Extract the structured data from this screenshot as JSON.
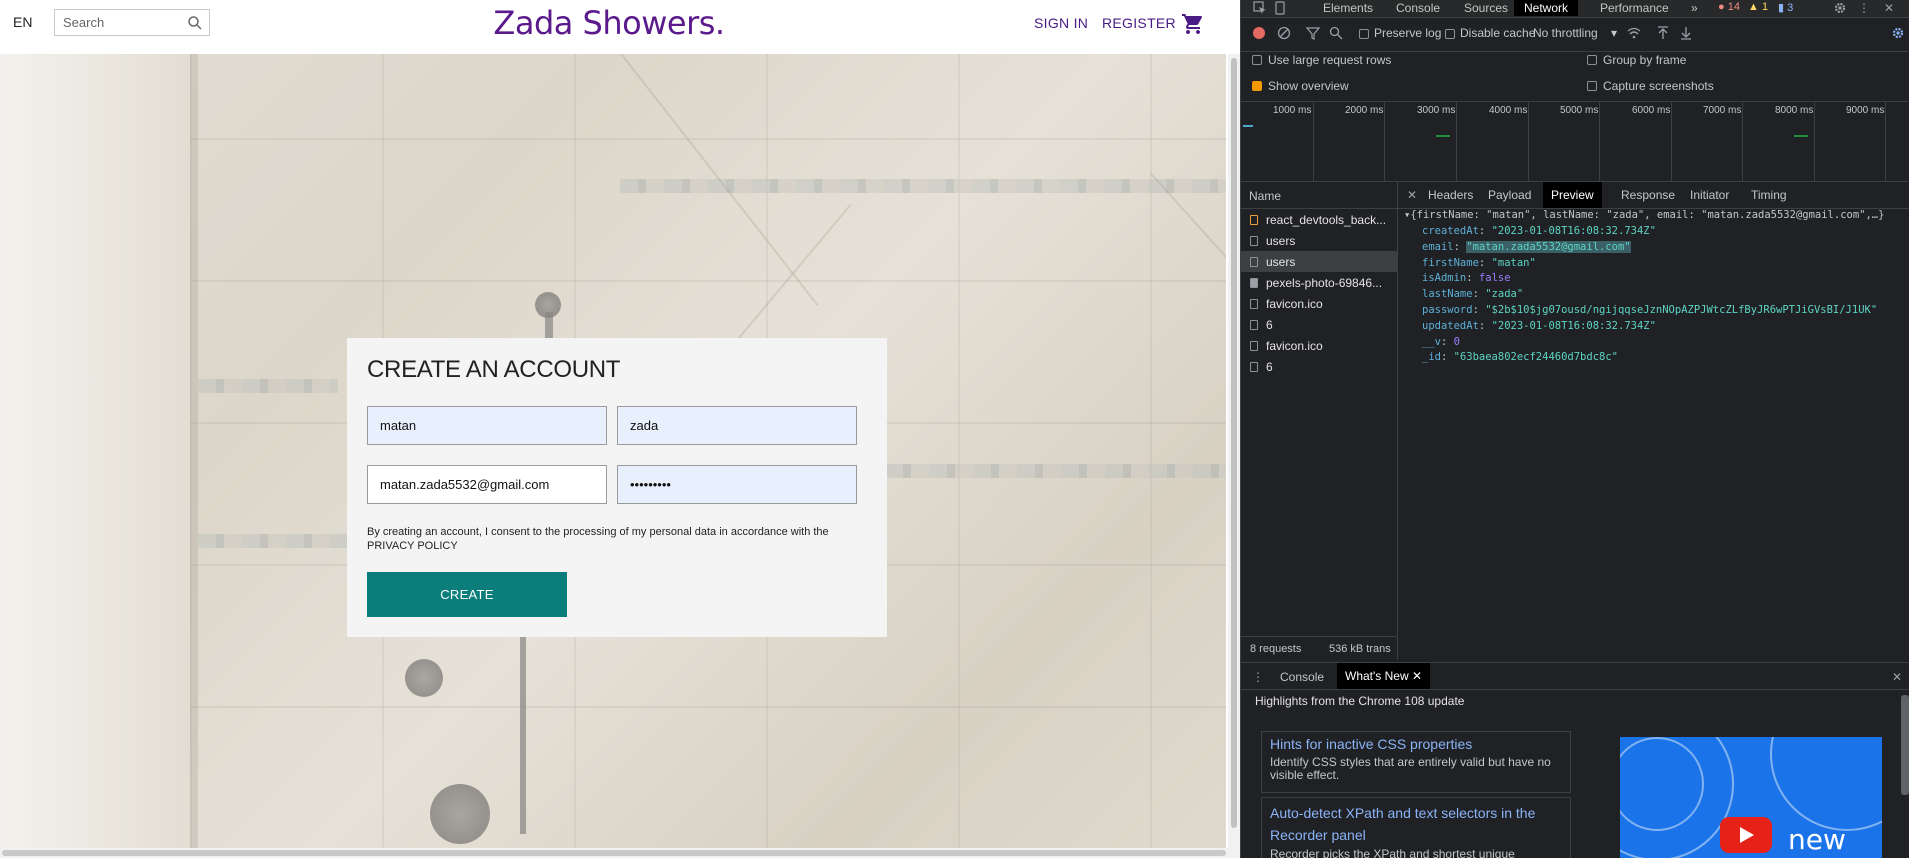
{
  "site": {
    "lang": "EN",
    "search_placeholder": "Search",
    "logo": "Zada Showers.",
    "nav": {
      "sign_in": "SIGN IN",
      "register": "REGISTER"
    },
    "form": {
      "title": "CREATE AN ACCOUNT",
      "first_name": "matan",
      "last_name": "zada",
      "email": "matan.zada5532@gmail.com",
      "password": "•••••••••",
      "consent_text": "By creating an account, I consent to the processing of my personal data in accordance with the",
      "consent_link": "PRIVACY POLICY",
      "create_label": "CREATE"
    }
  },
  "devtools": {
    "tabs": [
      "Elements",
      "Console",
      "Sources",
      "Network",
      "Performance"
    ],
    "active_tab": "Network",
    "more": "»",
    "badges": {
      "errors": "14",
      "warnings": "1",
      "messages": "3"
    },
    "toolbar": {
      "preserve_log": "Preserve log",
      "disable_cache": "Disable cache",
      "throttling": "No throttling"
    },
    "options": {
      "large_rows": "Use large request rows",
      "show_overview": "Show overview",
      "group_by_frame": "Group by frame",
      "capture_screenshots": "Capture screenshots"
    },
    "timeline": [
      "1000 ms",
      "2000 ms",
      "3000 ms",
      "4000 ms",
      "5000 ms",
      "6000 ms",
      "7000 ms",
      "8000 ms",
      "9000 ms"
    ],
    "name_header": "Name",
    "requests": [
      "react_devtools_back...",
      "users",
      "users",
      "pexels-photo-69846...",
      "favicon.ico",
      "6",
      "favicon.ico",
      "6"
    ],
    "status": {
      "requests": "8 requests",
      "transferred": "536 kB trans"
    },
    "detail_tabs": [
      "Headers",
      "Payload",
      "Preview",
      "Response",
      "Initiator",
      "Timing"
    ],
    "active_detail": "Preview",
    "preview": {
      "summary": "{firstName: \"matan\", lastName: \"zada\", email: \"matan.zada5532@gmail.com\",…}",
      "fields": [
        {
          "key": "createdAt",
          "value": "\"2023-01-08T16:08:32.734Z\"",
          "type": "s"
        },
        {
          "key": "email",
          "value": "\"matan.zada5532@gmail.com\"",
          "type": "s"
        },
        {
          "key": "firstName",
          "value": "\"matan\"",
          "type": "s"
        },
        {
          "key": "isAdmin",
          "value": "false",
          "type": "b"
        },
        {
          "key": "lastName",
          "value": "\"zada\"",
          "type": "s"
        },
        {
          "key": "password",
          "value": "\"$2b$10$jg07ousd/ngijqqseJznNOpAZPJWtcZLfByJR6wPTJiGVsBI/J1UK\"",
          "type": "s"
        },
        {
          "key": "updatedAt",
          "value": "\"2023-01-08T16:08:32.734Z\"",
          "type": "s"
        },
        {
          "key": "__v",
          "value": "0",
          "type": "n"
        },
        {
          "key": "_id",
          "value": "\"63baea802ecf24460d7bdc8c\"",
          "type": "s"
        }
      ]
    },
    "drawer": {
      "tabs": [
        "Console",
        "What's New"
      ],
      "active": "What's New",
      "headline": "Highlights from the Chrome 108 update",
      "cards": [
        {
          "title": "Hints for inactive CSS properties",
          "desc": "Identify CSS styles that are entirely valid but have no visible effect."
        },
        {
          "title": "Auto-detect XPath and text selectors in the Recorder panel",
          "desc": "Recorder picks the XPath and shortest unique"
        }
      ],
      "video_label": "new"
    }
  }
}
